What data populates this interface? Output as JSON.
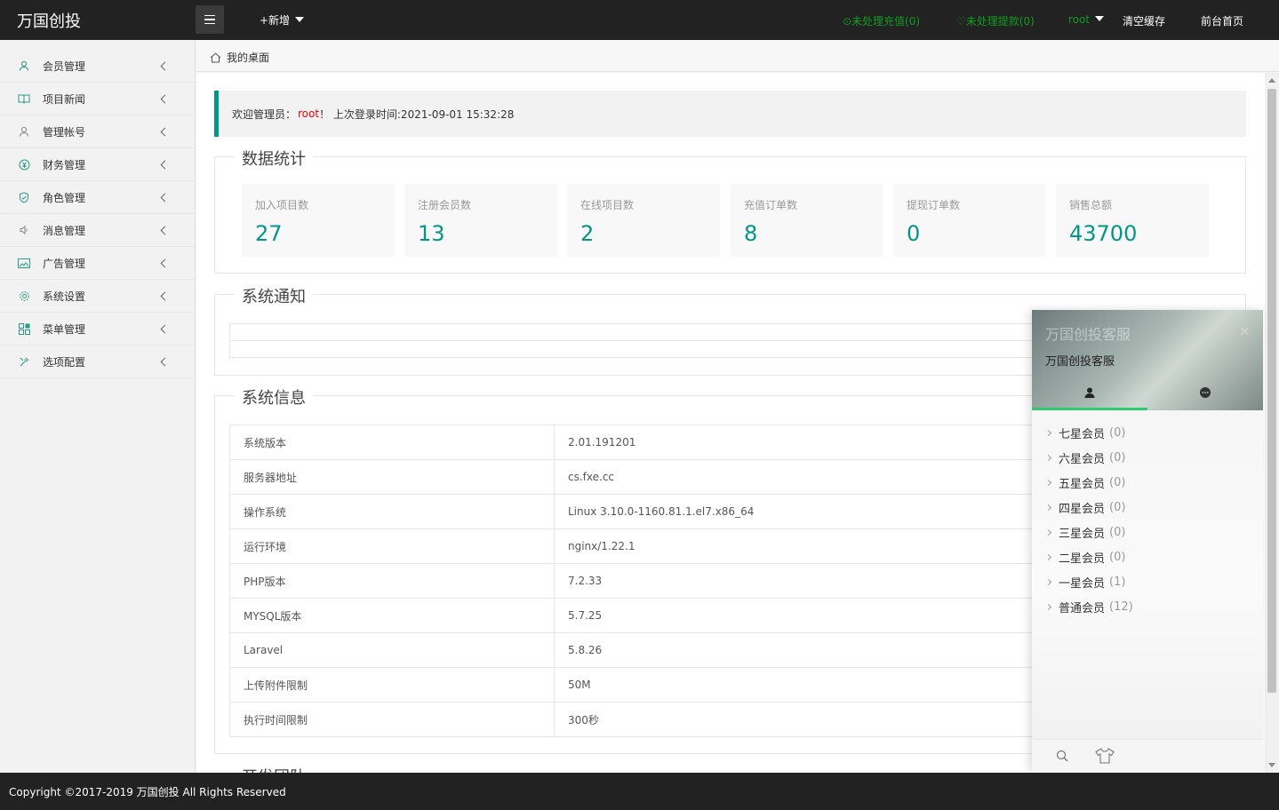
{
  "header": {
    "logo": "万国创投",
    "new_label": "+新增",
    "pending_recharge": "⊙未处理充值(0)",
    "pending_withdraw": "♡未处理提款(0)",
    "user": "root",
    "clear_cache": "清空缓存",
    "frontend_home": "前台首页",
    "green_color": "#0f9d20"
  },
  "sidebar": {
    "items": [
      {
        "label": "会员管理",
        "icon": "user-icon"
      },
      {
        "label": "项目新闻",
        "icon": "book-icon"
      },
      {
        "label": "管理帐号",
        "icon": "account-icon"
      },
      {
        "label": "财务管理",
        "icon": "yen-icon"
      },
      {
        "label": "角色管理",
        "icon": "shield-icon"
      },
      {
        "label": "消息管理",
        "icon": "speaker-icon"
      },
      {
        "label": "广告管理",
        "icon": "image-icon"
      },
      {
        "label": "系统设置",
        "icon": "gear-icon"
      },
      {
        "label": "菜单管理",
        "icon": "grid-icon"
      },
      {
        "label": "选项配置",
        "icon": "tools-icon"
      }
    ]
  },
  "tabbar": {
    "home": "我的桌面"
  },
  "welcome": {
    "prefix": "欢迎管理员：",
    "name": "root",
    "suffix": "！ 上次登录时间:2021-09-01 15:32:28"
  },
  "stats": {
    "title": "数据统计",
    "cards": [
      {
        "label": "加入项目数",
        "value": "27"
      },
      {
        "label": "注册会员数",
        "value": "13"
      },
      {
        "label": "在线项目数",
        "value": "2"
      },
      {
        "label": "充值订单数",
        "value": "8"
      },
      {
        "label": "提现订单数",
        "value": "0"
      },
      {
        "label": "销售总额",
        "value": "43700"
      }
    ],
    "accent": "#009688"
  },
  "notice": {
    "title": "系统通知"
  },
  "sysinfo": {
    "title": "系统信息",
    "rows": [
      {
        "k": "系统版本",
        "v": "2.01.191201"
      },
      {
        "k": "服务器地址",
        "v": "cs.fxe.cc"
      },
      {
        "k": "操作系统",
        "v": "Linux 3.10.0-1160.81.1.el7.x86_64"
      },
      {
        "k": "运行环境",
        "v": "nginx/1.22.1"
      },
      {
        "k": "PHP版本",
        "v": "7.2.33"
      },
      {
        "k": "MYSQL版本",
        "v": "5.7.25"
      },
      {
        "k": "Laravel",
        "v": "5.8.26"
      },
      {
        "k": "上传附件限制",
        "v": "50M"
      },
      {
        "k": "执行时间限制",
        "v": "300秒"
      }
    ]
  },
  "team": {
    "title": "开发团队"
  },
  "chat": {
    "title": "万国创投客服",
    "subtitle": "万国创投客服",
    "close": "×",
    "groups": [
      {
        "name": "七星会员",
        "count": "(0)"
      },
      {
        "name": "六星会员",
        "count": "(0)"
      },
      {
        "name": "五星会员",
        "count": "(0)"
      },
      {
        "name": "四星会员",
        "count": "(0)"
      },
      {
        "name": "三星会员",
        "count": "(0)"
      },
      {
        "name": "二星会员",
        "count": "(0)"
      },
      {
        "name": "一星会员",
        "count": "(1)"
      },
      {
        "name": "普通会员",
        "count": "(12)"
      }
    ]
  },
  "footer": {
    "copyright": "Copyright ©2017-2019 万国创投 All Rights Reserved"
  }
}
